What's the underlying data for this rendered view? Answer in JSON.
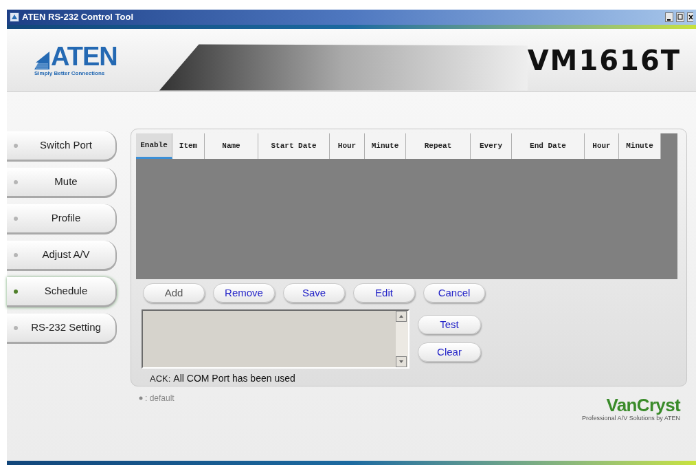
{
  "window": {
    "title": "ATEN RS-232 Control Tool"
  },
  "header": {
    "logo": "ATEN",
    "tagline": "Simply Better Connections",
    "model": "VM1616T"
  },
  "sidebar": {
    "items": [
      {
        "label": "Switch Port",
        "selected": false
      },
      {
        "label": "Mute",
        "selected": false
      },
      {
        "label": "Profile",
        "selected": false
      },
      {
        "label": "Adjust A/V",
        "selected": false
      },
      {
        "label": "Schedule",
        "selected": true
      },
      {
        "label": "RS-232 Setting",
        "selected": false
      }
    ]
  },
  "table": {
    "columns": [
      {
        "label": "Enable",
        "selected": true
      },
      {
        "label": "Item",
        "selected": false
      },
      {
        "label": "Name",
        "selected": false
      },
      {
        "label": "Start Date",
        "selected": false
      },
      {
        "label": "Hour",
        "selected": false
      },
      {
        "label": "Minute",
        "selected": false
      },
      {
        "label": "Repeat",
        "selected": false
      },
      {
        "label": "Every",
        "selected": false
      },
      {
        "label": "End Date",
        "selected": false
      },
      {
        "label": "Hour",
        "selected": false
      },
      {
        "label": "Minute",
        "selected": false
      }
    ]
  },
  "table_buttons": [
    {
      "label": "Add",
      "disabled": true
    },
    {
      "label": "Remove",
      "disabled": false
    },
    {
      "label": "Save",
      "disabled": false
    },
    {
      "label": "Edit",
      "disabled": false
    },
    {
      "label": "Cancel",
      "disabled": false
    }
  ],
  "console_buttons": [
    {
      "label": "Test",
      "disabled": false
    },
    {
      "label": "Clear",
      "disabled": false
    }
  ],
  "status": {
    "prefix": "ACK:",
    "message": "All COM Port has been used"
  },
  "legend": ": default",
  "footer_logo": {
    "name": "VanCryst",
    "tagline": "Professional A/V Solutions by ATEN"
  }
}
